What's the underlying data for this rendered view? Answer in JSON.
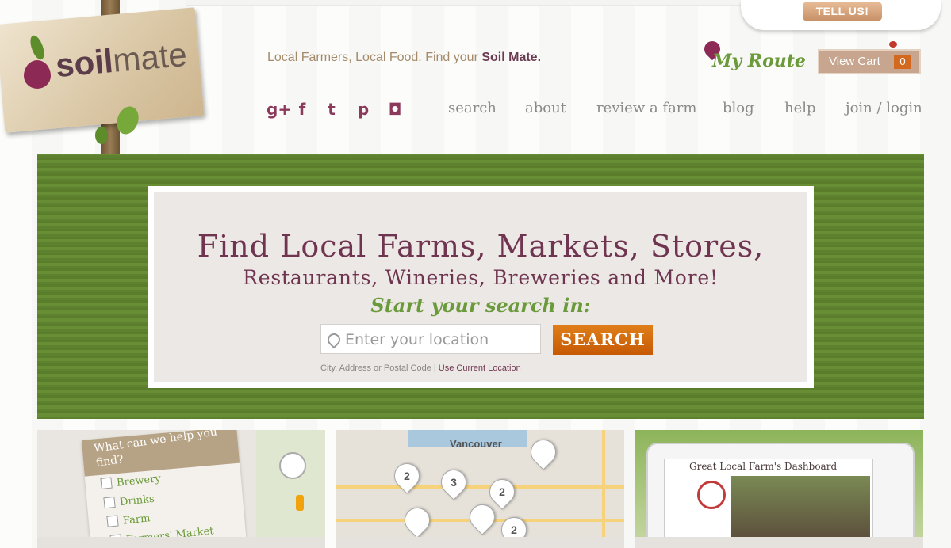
{
  "feedback": {
    "tell_us_label": "TELL US!"
  },
  "logo": {
    "part1": "soil",
    "part2": "mate"
  },
  "header": {
    "tagline_prefix": "Local Farmers, Local Food. Find your ",
    "tagline_strong": "Soil Mate.",
    "my_route_label": "My Route",
    "cart_label": "View Cart",
    "cart_count": "0"
  },
  "social": [
    {
      "icon": "google-plus-icon",
      "glyph": "g+"
    },
    {
      "icon": "facebook-icon",
      "glyph": "f"
    },
    {
      "icon": "twitter-icon",
      "glyph": "t"
    },
    {
      "icon": "pinterest-icon",
      "glyph": "p"
    },
    {
      "icon": "instagram-icon",
      "glyph": "◘"
    }
  ],
  "nav": {
    "search": "search",
    "about": "about",
    "review": "review a farm",
    "blog": "blog",
    "help": "help",
    "join": "join / login"
  },
  "hero": {
    "headline": "Find Local Farms, Markets, Stores,",
    "subheadline": "Restaurants, Wineries, Breweries and More!",
    "prompt": "Start your search in:",
    "location_placeholder": "Enter your location",
    "search_label": "SEARCH",
    "hint_text": "City, Address or Postal Code | ",
    "hint_link": "Use Current Location"
  },
  "cards": {
    "help_question": "What can we help you find?",
    "filters": [
      "Brewery",
      "Drinks",
      "Farm",
      "Farmers' Market"
    ],
    "map_city": "Vancouver",
    "map_markers": [
      "2",
      "3",
      "2",
      "2"
    ],
    "dashboard_title": "Great Local Farm's Dashboard"
  },
  "colors": {
    "brand_plum": "#6f3550",
    "brand_green": "#6a9a3a",
    "accent_orange": "#d2691e"
  }
}
